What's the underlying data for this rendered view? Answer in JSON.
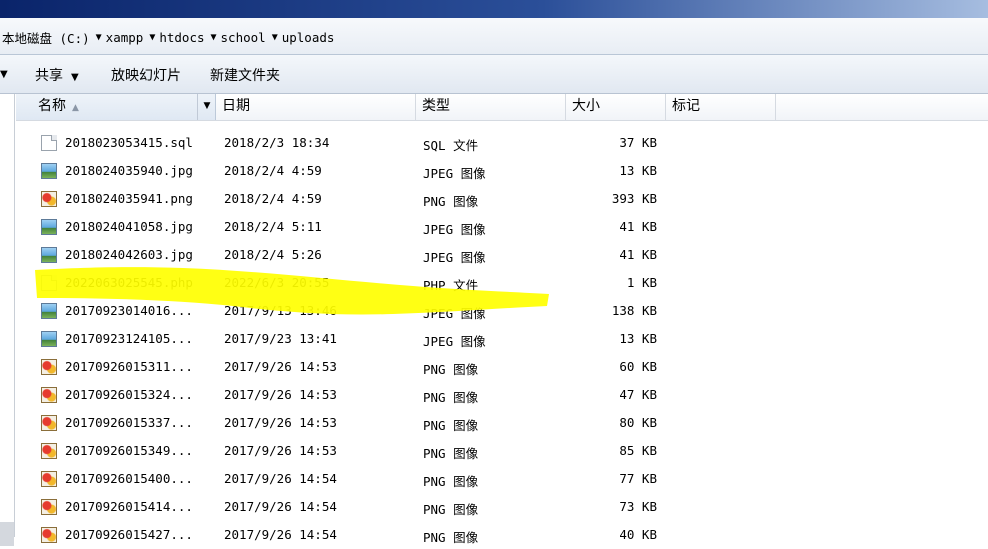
{
  "address": {
    "crumbs": [
      "本地磁盘 (C:)",
      "xampp",
      "htdocs",
      "school",
      "uploads"
    ]
  },
  "toolbar": {
    "share_label": "共享",
    "slideshow_label": "放映幻灯片",
    "new_folder_label": "新建文件夹"
  },
  "columns": {
    "name": "名称",
    "date": "日期",
    "type": "类型",
    "size": "大小",
    "tags": "标记"
  },
  "files": [
    {
      "name": "2018023053415.sql",
      "date": "2018/2/3 18:34",
      "type": "SQL 文件",
      "size": "37 KB",
      "icon": "document-icon"
    },
    {
      "name": "2018024035940.jpg",
      "date": "2018/2/4 4:59",
      "type": "JPEG 图像",
      "size": "13 KB",
      "icon": "jpeg-image-icon"
    },
    {
      "name": "2018024035941.png",
      "date": "2018/2/4 4:59",
      "type": "PNG 图像",
      "size": "393 KB",
      "icon": "png-image-icon"
    },
    {
      "name": "2018024041058.jpg",
      "date": "2018/2/4 5:11",
      "type": "JPEG 图像",
      "size": "41 KB",
      "icon": "jpeg-image-icon"
    },
    {
      "name": "2018024042603.jpg",
      "date": "2018/2/4 5:26",
      "type": "JPEG 图像",
      "size": "41 KB",
      "icon": "jpeg-image-icon"
    },
    {
      "name": "2022063025545.php",
      "date": "2022/6/3 20:55",
      "type": "PHP 文件",
      "size": "1 KB",
      "icon": "document-icon"
    },
    {
      "name": "20170923014016...",
      "date": "2017/9/13 13:46",
      "type": "JPEG 图像",
      "size": "138 KB",
      "icon": "jpeg-image-icon"
    },
    {
      "name": "20170923124105...",
      "date": "2017/9/23 13:41",
      "type": "JPEG 图像",
      "size": "13 KB",
      "icon": "jpeg-image-icon"
    },
    {
      "name": "20170926015311...",
      "date": "2017/9/26 14:53",
      "type": "PNG 图像",
      "size": "60 KB",
      "icon": "png-image-icon"
    },
    {
      "name": "20170926015324...",
      "date": "2017/9/26 14:53",
      "type": "PNG 图像",
      "size": "47 KB",
      "icon": "png-image-icon"
    },
    {
      "name": "20170926015337...",
      "date": "2017/9/26 14:53",
      "type": "PNG 图像",
      "size": "80 KB",
      "icon": "png-image-icon"
    },
    {
      "name": "20170926015349...",
      "date": "2017/9/26 14:53",
      "type": "PNG 图像",
      "size": "85 KB",
      "icon": "png-image-icon"
    },
    {
      "name": "20170926015400...",
      "date": "2017/9/26 14:54",
      "type": "PNG 图像",
      "size": "77 KB",
      "icon": "png-image-icon"
    },
    {
      "name": "20170926015414...",
      "date": "2017/9/26 14:54",
      "type": "PNG 图像",
      "size": "73 KB",
      "icon": "png-image-icon"
    },
    {
      "name": "20170926015427...",
      "date": "2017/9/26 14:54",
      "type": "PNG 图像",
      "size": "40 KB",
      "icon": "png-image-icon"
    }
  ],
  "colors": {
    "highlight": "#ffff00"
  }
}
